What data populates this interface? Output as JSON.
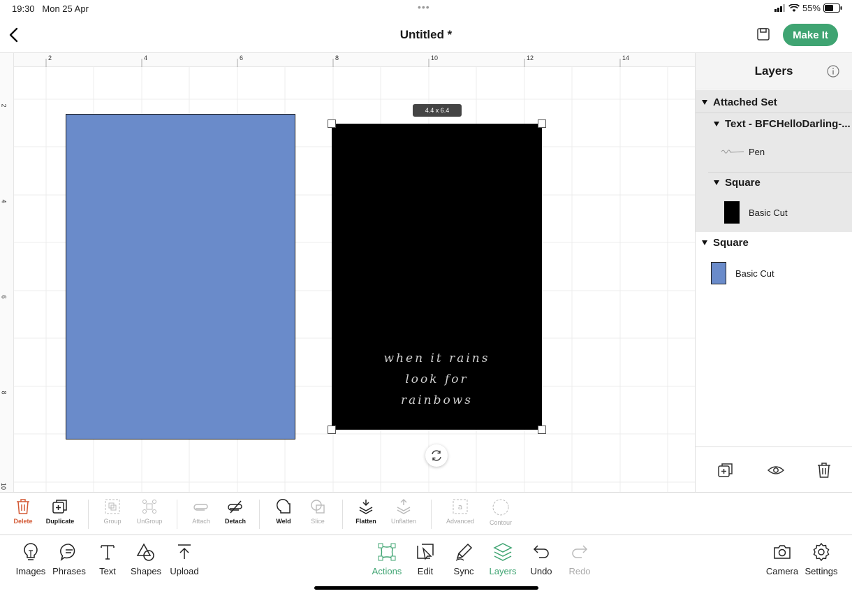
{
  "status_bar": {
    "time": "19:30",
    "date": "Mon 25 Apr",
    "dots": "•••",
    "battery": "55%"
  },
  "header": {
    "title": "Untitled *",
    "make_it_label": "Make It",
    "back_icon": "chevron-left-icon",
    "save_icon": "save-icon"
  },
  "canvas": {
    "ruler_top": [
      "2",
      "4",
      "6",
      "8",
      "10",
      "12",
      "14"
    ],
    "ruler_left": [
      "2",
      "4",
      "6",
      "8",
      "10"
    ],
    "size_label": "4.4 x 6.4",
    "phrase_lines": [
      "when it rains",
      "look for",
      "rainbows"
    ],
    "blue_color": "#6a8bca"
  },
  "layers": {
    "title": "Layers",
    "attached_set": "Attached Set",
    "text_layer": "Text - BFCHelloDarling-...",
    "pen_label": "Pen",
    "square1": "Square",
    "basic_cut_1": "Basic Cut",
    "square2": "Square",
    "basic_cut_2": "Basic Cut"
  },
  "edit_tools": [
    {
      "label": "Delete"
    },
    {
      "label": "Duplicate"
    },
    {
      "label": "Group"
    },
    {
      "label": "UnGroup"
    },
    {
      "label": "Attach"
    },
    {
      "label": "Detach"
    },
    {
      "label": "Weld"
    },
    {
      "label": "Slice"
    },
    {
      "label": "Flatten"
    },
    {
      "label": "Unflatten"
    },
    {
      "label": "Advanced"
    },
    {
      "label": "Contour"
    }
  ],
  "bottom_tabs": [
    {
      "label": "Images"
    },
    {
      "label": "Phrases"
    },
    {
      "label": "Text"
    },
    {
      "label": "Shapes"
    },
    {
      "label": "Upload"
    },
    {
      "label": "Actions"
    },
    {
      "label": "Edit"
    },
    {
      "label": "Sync"
    },
    {
      "label": "Layers"
    },
    {
      "label": "Undo"
    },
    {
      "label": "Redo"
    },
    {
      "label": "Camera"
    },
    {
      "label": "Settings"
    }
  ],
  "accent_color": "#3fa472",
  "delete_color": "#d35a36"
}
